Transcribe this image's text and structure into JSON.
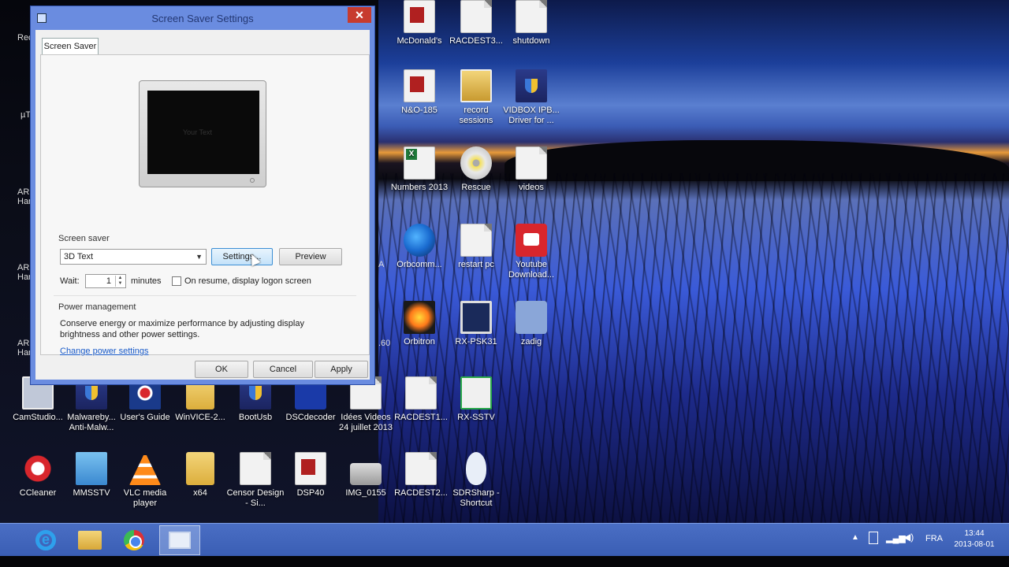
{
  "dialog": {
    "title": "Screen Saver Settings",
    "tab_label": "Screen Saver",
    "preview_text": "Your Text",
    "screensaver_group_label": "Screen saver",
    "screensaver_selected": "3D Text",
    "settings_label": "Settings...",
    "preview_label": "Preview",
    "wait_label": "Wait:",
    "wait_value": "1",
    "minutes_label": "minutes",
    "resume_label": "On resume, display logon screen",
    "power_group_label": "Power management",
    "power_desc_line1": "Conserve energy or maximize performance by adjusting display",
    "power_desc_line2": "brightness and other power settings.",
    "power_link": "Change power settings",
    "ok_label": "OK",
    "cancel_label": "Cancel",
    "apply_label": "Apply",
    "close_glyph": "✕"
  },
  "desktop_icons": [
    {
      "label": "McDonald's",
      "icon": "pdf-icon"
    },
    {
      "label": "RACDEST3...",
      "icon": "document-icon"
    },
    {
      "label": "shutdown",
      "icon": "shortcut-icon"
    },
    {
      "label": "N&O-185",
      "icon": "pdf-icon"
    },
    {
      "label": "record sessions",
      "icon": "zip-folder-icon"
    },
    {
      "label": "VIDBOX IPB... Driver for ...",
      "icon": "shield-icon"
    },
    {
      "label": "Numbers 2013",
      "icon": "excel-icon"
    },
    {
      "label": "Rescue",
      "icon": "iso-disc-icon"
    },
    {
      "label": "videos",
      "icon": "document-icon"
    },
    {
      "label": "Orbcomm...",
      "icon": "globe-icon"
    },
    {
      "label": "restart pc",
      "icon": "shortcut-icon"
    },
    {
      "label": "Youtube Download...",
      "icon": "youtube-downloader-icon"
    },
    {
      "label": "Orbitron",
      "icon": "orbitron-icon"
    },
    {
      "label": "RX-PSK31",
      "icon": "screen-icon"
    },
    {
      "label": "zadig",
      "icon": "zadig-icon"
    },
    {
      "label": "CamStudio...",
      "icon": "camstudio-icon"
    },
    {
      "label": "Malwareby... Anti-Malw...",
      "icon": "malwarebytes-icon"
    },
    {
      "label": "User's Guide",
      "icon": "uk-flag-icon"
    },
    {
      "label": "WinVICE-2...",
      "icon": "folder-icon"
    },
    {
      "label": "BootUsb",
      "icon": "shield-icon"
    },
    {
      "label": "DSCdecoder",
      "icon": "dsc-decoder-icon"
    },
    {
      "label": "Idées Videos 24 juillet 2013",
      "icon": "document-icon"
    },
    {
      "label": "RACDEST1...",
      "icon": "document-icon"
    },
    {
      "label": "RX-SSTV",
      "icon": "rx-sstv-icon"
    },
    {
      "label": "CCleaner",
      "icon": "ccleaner-icon"
    },
    {
      "label": "MMSSTV",
      "icon": "mmsstv-icon"
    },
    {
      "label": "VLC media player",
      "icon": "vlc-icon"
    },
    {
      "label": "x64",
      "icon": "folder-icon"
    },
    {
      "label": "Censor Design - Si...",
      "icon": "document-icon"
    },
    {
      "label": "DSP40",
      "icon": "pdf-icon"
    },
    {
      "label": "IMG_0155",
      "icon": "image-icon"
    },
    {
      "label": "RACDEST2...",
      "icon": "document-icon"
    },
    {
      "label": "SDRSharp - Shortcut",
      "icon": "mouse-icon"
    }
  ],
  "left_edge_labels": {
    "rec": "Rec",
    "mu": "µT",
    "ar1": "ARI Har",
    "ar2": "ARI Har",
    "ar3": "ARI Har",
    "edge_a": "A",
    "edge_60": ".60"
  },
  "taskbar": {
    "apps": [
      "internet-explorer-icon",
      "file-explorer-icon",
      "chrome-icon",
      "display-settings-icon"
    ],
    "language": "FRA",
    "time": "13:44",
    "date": "2013-08-01"
  }
}
